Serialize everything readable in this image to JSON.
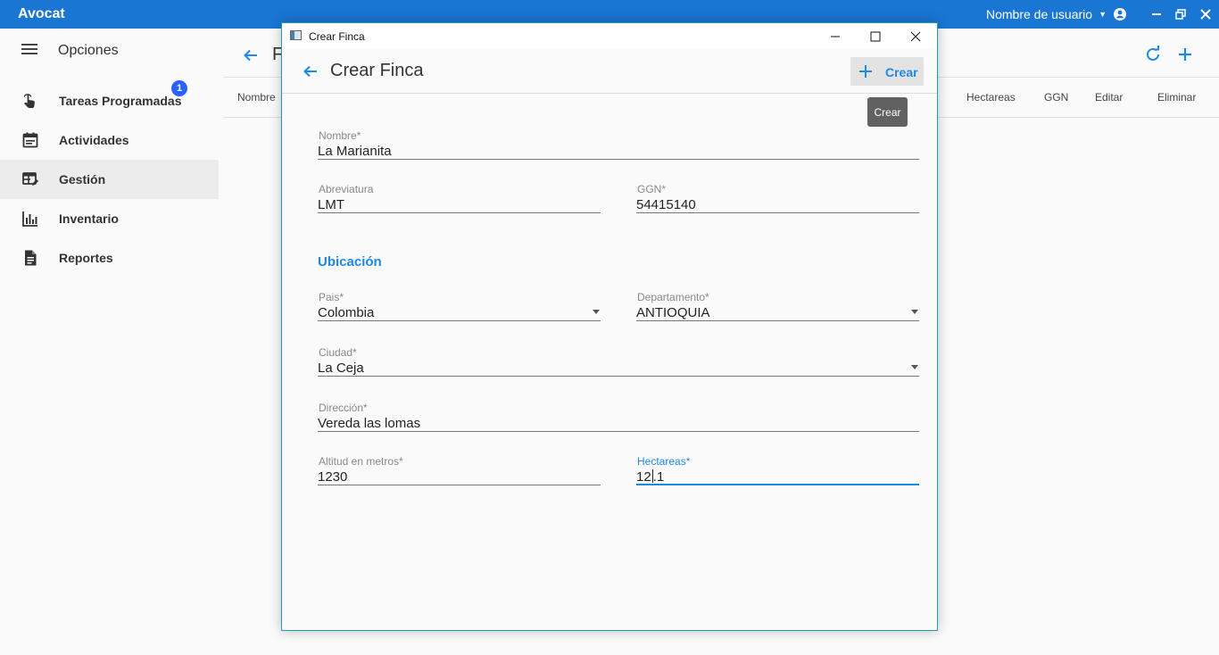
{
  "app": {
    "title": "Avocat",
    "user_label": "Nombre de usuario"
  },
  "sidebar": {
    "header_label": "Opciones",
    "items": [
      {
        "label": "Tareas Programadas",
        "icon": "touch-hand-icon",
        "badge": "1"
      },
      {
        "label": "Actividades",
        "icon": "calendar-icon"
      },
      {
        "label": "Gestión",
        "icon": "table-edit-icon",
        "active": true
      },
      {
        "label": "Inventario",
        "icon": "bar-chart-icon"
      },
      {
        "label": "Reportes",
        "icon": "document-icon"
      }
    ]
  },
  "background_page": {
    "title_partial": "F",
    "columns": [
      "Nombre",
      "Hectareas",
      "GGN",
      "Editar",
      "Eliminar"
    ]
  },
  "dialog": {
    "window_title": "Crear Finca",
    "header_title": "Crear Finca",
    "create_button_label": "Crear",
    "tooltip": "Crear",
    "section_location": "Ubicación",
    "fields": {
      "nombre": {
        "label": "Nombre*",
        "value": "La Marianita"
      },
      "abreviatura": {
        "label": "Abreviatura",
        "value": "LMT"
      },
      "ggn": {
        "label": "GGN*",
        "value": "54415140"
      },
      "pais": {
        "label": "Pais*",
        "value": "Colombia"
      },
      "departamento": {
        "label": "Departamento*",
        "value": "ANTIOQUIA"
      },
      "ciudad": {
        "label": "Ciudad*",
        "value": "La Ceja"
      },
      "direccion": {
        "label": "Dirección*",
        "value": "Vereda las lomas"
      },
      "altitud": {
        "label": "Altitud en metros*",
        "value": "1230"
      },
      "hectareas": {
        "label": "Hectareas*",
        "value_before_caret": "12",
        "value_after_caret": ".1"
      }
    }
  },
  "colors": {
    "appbar": "#1976d2",
    "accent": "#1e88e5",
    "badge": "#2962ff"
  }
}
